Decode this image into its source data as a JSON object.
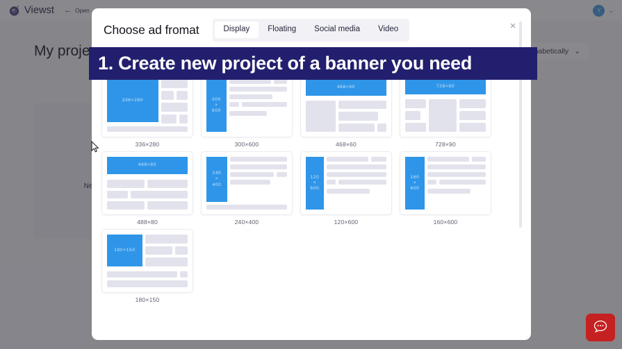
{
  "app": {
    "brand_name": "Viewst",
    "logo_icon": "viewst-logo-icon",
    "back_label": "Open",
    "back_icon": "arrow-left-icon",
    "avatar_initial": "Y",
    "account_chevron_icon": "chevron-down-icon"
  },
  "page": {
    "title": "My projects",
    "sort_label": "Alphabetically",
    "sort_chevron_icon": "chevron-down-icon",
    "new_project_label": "New project",
    "new_project_icon": "plus-icon"
  },
  "modal": {
    "title": "Choose ad fromat",
    "close_icon": "close-icon",
    "close_label": "×",
    "tabs": [
      {
        "label": "Display",
        "active": true
      },
      {
        "label": "Floating",
        "active": false
      },
      {
        "label": "Social media",
        "active": false
      },
      {
        "label": "Video",
        "active": false
      }
    ],
    "formats": [
      {
        "label": "336×280",
        "ad_text": "336×280",
        "layout": "square-left"
      },
      {
        "label": "300×600",
        "ad_text": "300\n×\n600",
        "layout": "tall-left"
      },
      {
        "label": "468×60",
        "ad_text": "468×60",
        "layout": "wide-top"
      },
      {
        "label": "728×90",
        "ad_text": "728×90",
        "layout": "wide-top-3col"
      },
      {
        "label": "488×80",
        "ad_text": "488×80",
        "layout": "wide-top-rows"
      },
      {
        "label": "240×400",
        "ad_text": "240\n×\n400",
        "layout": "tall-left"
      },
      {
        "label": "120×600",
        "ad_text": "120\n×\n600",
        "layout": "narrow-tall-left"
      },
      {
        "label": "160×600",
        "ad_text": "160\n×\n600",
        "layout": "narrow-tall-left"
      },
      {
        "label": "180×150",
        "ad_text": "180×150",
        "layout": "square-left"
      }
    ]
  },
  "instruction": {
    "text": "1. Create new project of a banner you need",
    "background_color": "#221f6e",
    "text_color": "#ffffff"
  },
  "chat": {
    "icon": "chat-bubble-icon",
    "background_color": "#c62121"
  },
  "colors": {
    "ad_blue": "#2f95e8",
    "skeleton": "#e2e2ec",
    "navy": "#221f6e",
    "overlay": "rgba(40,40,48,.55)"
  }
}
